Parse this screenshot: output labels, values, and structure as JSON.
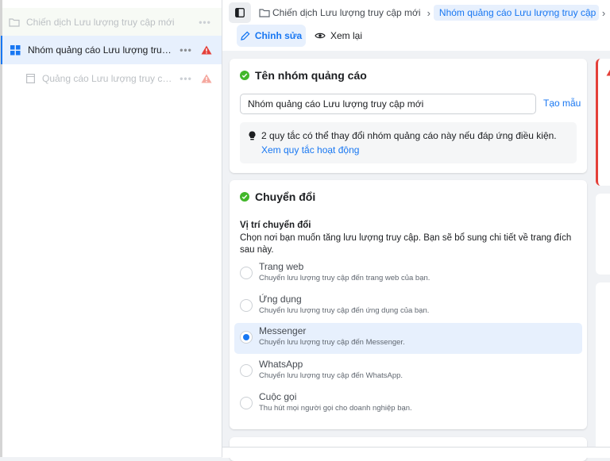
{
  "sidebar": {
    "campaign_label": "Chiến dịch Lưu lượng truy cập mới",
    "adset_label": "Nhóm quảng cáo Lưu lượng truy cập mới",
    "ad_label": "Quảng cáo Lưu lượng truy cập mới",
    "more_glyph": "•••"
  },
  "header": {
    "crumb_campaign": "Chiến dịch Lưu lượng truy cập mới",
    "crumb_adset": "Nhóm quảng cáo Lưu lượng truy cập mới",
    "edit_label": "Chỉnh sửa",
    "preview_label": "Xem lại"
  },
  "adset_name_section": {
    "title": "Tên nhóm quảng cáo",
    "name_value": "Nhóm quảng cáo Lưu lượng truy cập mới",
    "template_link": "Tạo mẫu",
    "tip_text": "2 quy tắc có thể thay đổi nhóm quảng cáo này nếu đáp ứng điều kiện.",
    "tip_link": "Xem quy tắc hoạt động"
  },
  "conversion_section": {
    "title": "Chuyển đổi",
    "location_label": "Vị trí chuyển đổi",
    "location_desc": "Chọn nơi bạn muốn tăng lưu lượng truy cập. Bạn sẽ bổ sung chi tiết về trang đích sau này.",
    "options": [
      {
        "title": "Trang web",
        "desc": "Chuyển lưu lượng truy cập đến trang web của bạn.",
        "selected": false
      },
      {
        "title": "Ứng dụng",
        "desc": "Chuyển lưu lượng truy cập đến ứng dụng của bạn.",
        "selected": false
      },
      {
        "title": "Messenger",
        "desc": "Chuyển lưu lượng truy cập đến Messenger.",
        "selected": true
      },
      {
        "title": "WhatsApp",
        "desc": "Chuyển lưu lượng truy cập đến WhatsApp.",
        "selected": false
      },
      {
        "title": "Cuộc gọi",
        "desc": "Thu hút mọi người gọi cho doanh nghiệp bạn.",
        "selected": false
      }
    ]
  },
  "colors": {
    "accent": "#1877f2",
    "success": "#42b72a",
    "error": "#e4403a"
  }
}
